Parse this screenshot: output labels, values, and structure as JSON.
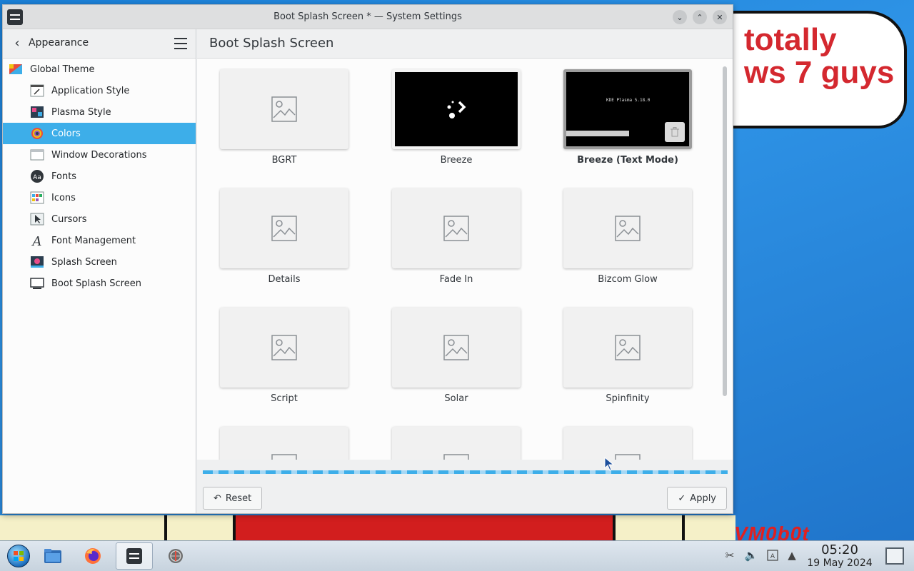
{
  "window": {
    "title": "Boot Splash Screen * — System Settings"
  },
  "sidebar": {
    "header_title": "Appearance",
    "items": [
      {
        "label": "Global Theme"
      },
      {
        "label": "Application Style"
      },
      {
        "label": "Plasma Style"
      },
      {
        "label": "Colors"
      },
      {
        "label": "Window Decorations"
      },
      {
        "label": "Fonts"
      },
      {
        "label": "Icons"
      },
      {
        "label": "Cursors"
      },
      {
        "label": "Font Management"
      },
      {
        "label": "Splash Screen"
      },
      {
        "label": "Boot Splash Screen"
      }
    ],
    "active_item": "Colors"
  },
  "main": {
    "title": "Boot Splash Screen",
    "themes": [
      {
        "label": "BGRT"
      },
      {
        "label": "Breeze"
      },
      {
        "label": "Breeze (Text Mode)",
        "preview_text": "KDE Plasma 5.18.0"
      },
      {
        "label": "Details"
      },
      {
        "label": "Fade In"
      },
      {
        "label": "Bizcom Glow"
      },
      {
        "label": "Script"
      },
      {
        "label": "Solar"
      },
      {
        "label": "Spinfinity"
      }
    ],
    "current_theme": "Breeze (Text Mode)"
  },
  "footer": {
    "reset_label": "Reset",
    "apply_label": "Apply"
  },
  "desktop": {
    "bubble_line1": "totally",
    "bubble_line2": "ws 7 guys",
    "watermark": "VM0b0t"
  },
  "taskbar": {
    "time": "05:20",
    "date": "19 May 2024"
  },
  "colors": {
    "accent": "#3daee9",
    "bubble_text": "#d4282f"
  }
}
